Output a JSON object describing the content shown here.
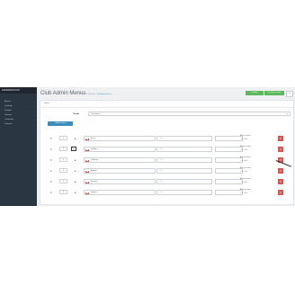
{
  "sidebar": {
    "brand": "ADMINISTRATOR",
    "items": [
      {
        "label": "Ajustes",
        "icon": "chevron-right-icon"
      },
      {
        "label": "Catálogo",
        "icon": "chevron-right-icon"
      },
      {
        "label": "Pedidos",
        "icon": "chevron-right-icon"
      },
      {
        "label": "Clientes",
        "icon": "chevron-right-icon"
      },
      {
        "label": "Contenido",
        "icon": "chevron-right-icon"
      },
      {
        "label": "Informes",
        "icon": "chevron-right-icon"
      }
    ]
  },
  "header": {
    "title": "Club Admin Menus",
    "breadcrumb": [
      "Inicio",
      "Módulos",
      "Club Admin Menus"
    ],
    "save_label": "Guardar",
    "save_close_label": "Guardar y cerrar",
    "more_label": "▾"
  },
  "panel": {
    "heading": "Editar",
    "store_label": "Tienda",
    "store_value": "Por defecto",
    "add_button": "+ Añadir menú",
    "rows": [
      {
        "order": "1",
        "name": "Inicio",
        "link": "http://...",
        "link2": "",
        "target_label": "Abrir en nueva",
        "target_options": "○ Sí ○ No"
      },
      {
        "order": "2",
        "name": "Pedidos",
        "link": "http://...",
        "link2": "",
        "target_label": "Abrir en nueva",
        "target_options": "○ Sí ○ No"
      },
      {
        "order": "3",
        "name": "Catálogo",
        "link": "http://...",
        "link2": "",
        "target_label": "Abrir en nueva",
        "target_options": "○ Sí ○ No"
      },
      {
        "order": "4",
        "name": "Ajustes",
        "link": "http://...",
        "link2": "",
        "target_label": "Abrir en nueva",
        "target_options": "○ Sí ○ No"
      },
      {
        "order": "5",
        "name": "Informes",
        "link": "http://...",
        "link2": "",
        "target_label": "Abrir en nueva",
        "target_options": "○ Sí ○ No"
      },
      {
        "order": "6",
        "name": "Clientes",
        "link": "http://...",
        "link2": "",
        "target_label": "Abrir en nueva",
        "target_options": "○ Sí ○ No"
      }
    ]
  },
  "colors": {
    "sidebar_bg": "#2b3643",
    "success": "#5cb85c",
    "primary": "#3c8dbc",
    "danger": "#d9534f"
  }
}
